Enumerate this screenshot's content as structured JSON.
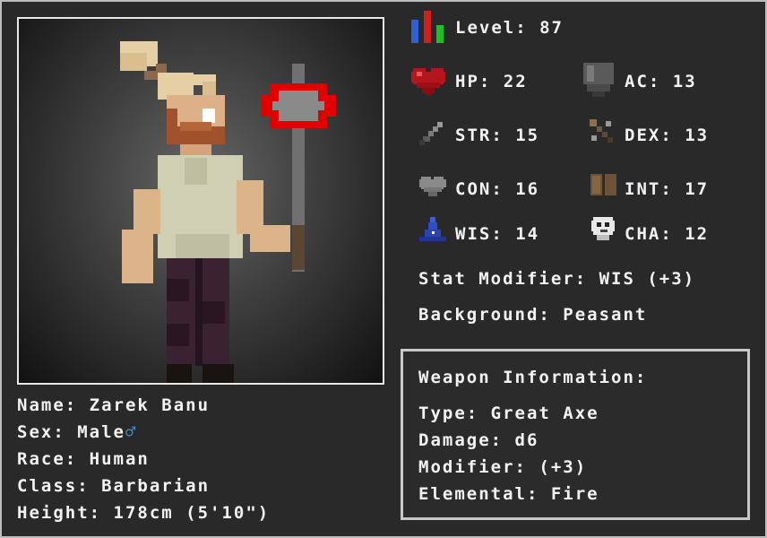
{
  "character": {
    "name_label": "Name:",
    "name": "Zarek Banu",
    "sex_label": "Sex:",
    "sex": "Male",
    "sex_symbol": "♂",
    "race_label": "Race:",
    "race": "Human",
    "class_label": "Class:",
    "class": "Barbarian",
    "height_label": "Height:",
    "height": "178cm (5'10\")"
  },
  "stats": {
    "level_label": "Level:",
    "level": "87",
    "hp_label": "HP:",
    "hp": "22",
    "ac_label": "AC:",
    "ac": "13",
    "str_label": "STR:",
    "str": "15",
    "dex_label": "DEX:",
    "dex": "13",
    "con_label": "CON:",
    "con": "16",
    "int_label": "INT:",
    "int": "17",
    "wis_label": "WIS:",
    "wis": "14",
    "cha_label": "CHA:",
    "cha": "12",
    "modifier_label": "Stat Modifier:",
    "modifier": "WIS (+3)",
    "background_label": "Background:",
    "background": "Peasant"
  },
  "weapon": {
    "title": "Weapon Information:",
    "type_label": "Type:",
    "type": "Great Axe",
    "damage_label": "Damage:",
    "damage": "d6",
    "modifier_label": "Modifier:",
    "modifier": "(+3)",
    "elemental_label": "Elemental:",
    "elemental": "Fire"
  },
  "icons": {
    "level": "level-bars-icon",
    "hp": "heart-icon",
    "ac": "shield-icon",
    "str": "sword-icon",
    "dex": "crossbow-icon",
    "con": "grey-heart-icon",
    "int": "book-icon",
    "wis": "wizard-hat-icon",
    "cha": "face-mask-icon"
  },
  "colors": {
    "background": "#2b2b2b",
    "text": "#f2f2f2",
    "male_symbol": "#3d8ed9",
    "hp_heart": "#b3161c",
    "fire_axe": "#e00000"
  }
}
